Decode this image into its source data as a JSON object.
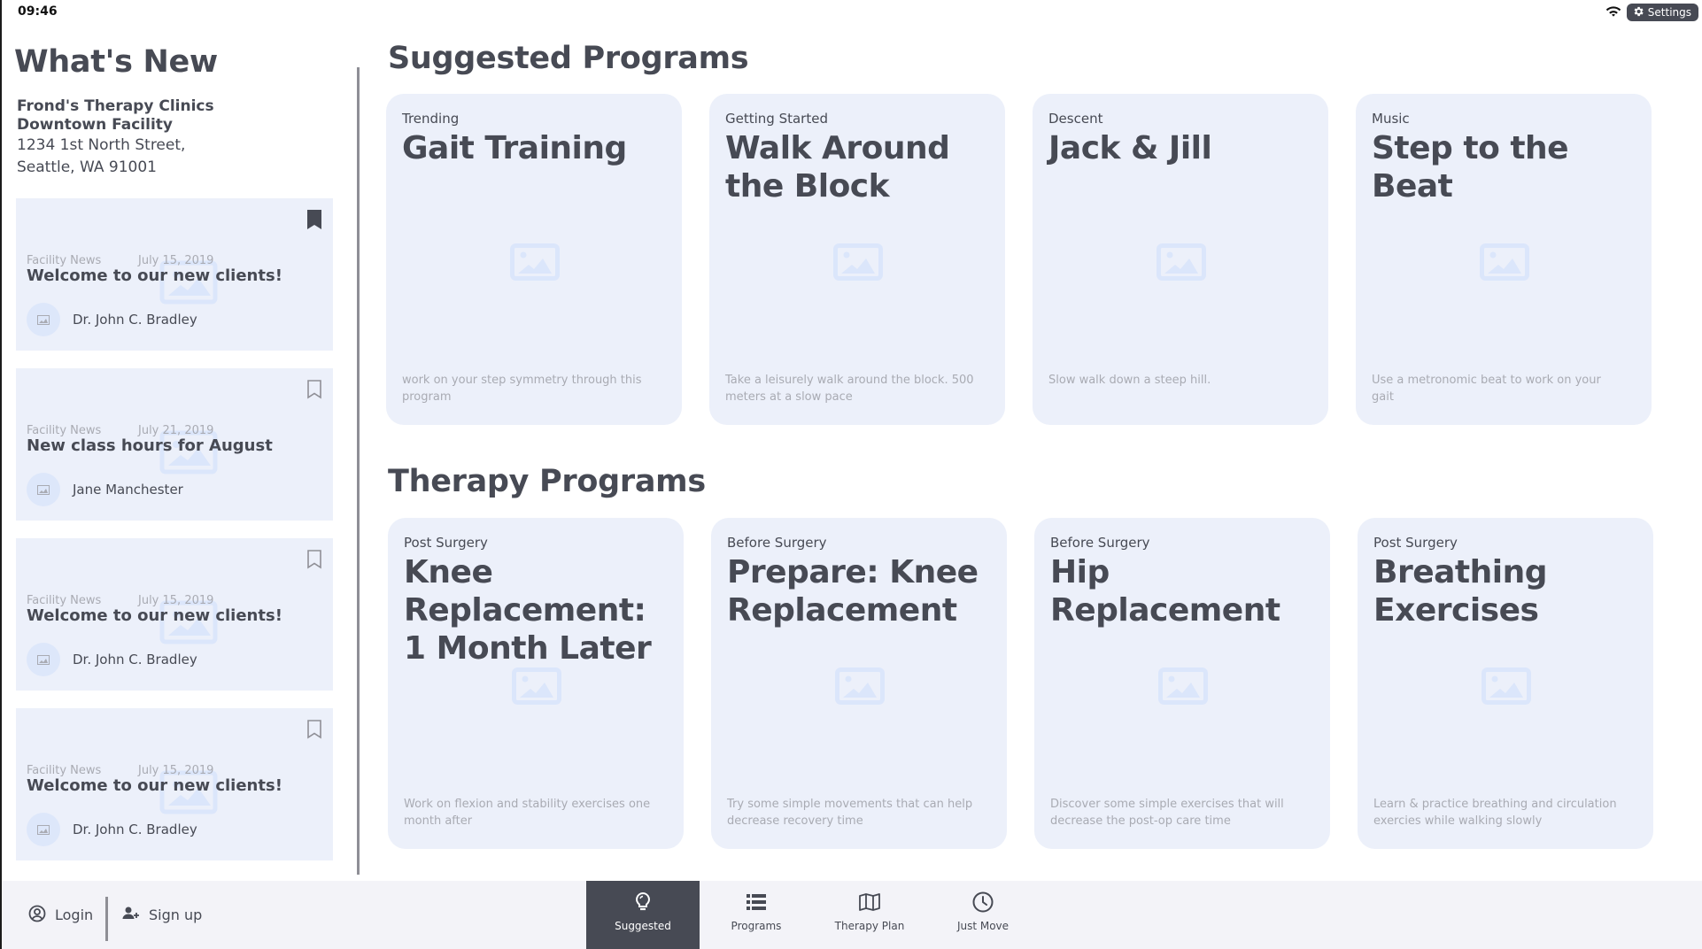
{
  "status_bar": {
    "time": "09:46",
    "wifi_icon": "wifi-icon",
    "settings_label": "Settings",
    "settings_icon": "gear-icon"
  },
  "sidebar": {
    "title": "What's New",
    "facility": {
      "name": "Frond's Therapy Clinics",
      "branch": "Downtown Facility",
      "address_line1": "1234 1st North Street,",
      "address_line2": "Seattle, WA 91001"
    },
    "news": [
      {
        "category": "Facility News",
        "date": "July 15, 2019",
        "title": "Welcome to our new clients!",
        "author": "Dr. John C. Bradley",
        "bookmarked": true
      },
      {
        "category": "Facility News",
        "date": "July 21, 2019",
        "title": "New class hours for August",
        "author": "Jane Manchester",
        "bookmarked": false
      },
      {
        "category": "Facility News",
        "date": "July 15, 2019",
        "title": "Welcome to our new clients!",
        "author": "Dr. John C. Bradley",
        "bookmarked": false
      },
      {
        "category": "Facility News",
        "date": "July 15, 2019",
        "title": "Welcome to our new clients!",
        "author": "Dr. John C. Bradley",
        "bookmarked": false
      }
    ]
  },
  "suggested": {
    "title": "Suggested Programs",
    "programs": [
      {
        "category": "Trending",
        "title": "Gait Training",
        "description": "work on your step symmetry through this program"
      },
      {
        "category": "Getting Started",
        "title": "Walk Around the Block",
        "description": "Take a leisurely walk around the block. 500 meters at a slow pace"
      },
      {
        "category": "Descent",
        "title": "Jack & Jill",
        "description": "Slow walk down a steep hill."
      },
      {
        "category": "Music",
        "title": "Step to the Beat",
        "description": "Use a metronomic beat to work on your gait"
      }
    ]
  },
  "therapy": {
    "title": "Therapy Programs",
    "programs": [
      {
        "category": "Post Surgery",
        "title": "Knee Replacement: 1 Month Later",
        "description": "Work on flexion and stability exercises one month after"
      },
      {
        "category": "Before Surgery",
        "title": "Prepare: Knee Replacement",
        "description": "Try some simple movements that can help decrease recovery time"
      },
      {
        "category": "Before Surgery",
        "title": "Hip Replacement",
        "description": "Discover some simple exercises that will decrease the post-op care time"
      },
      {
        "category": "Post Surgery",
        "title": "Breathing Exercises",
        "description": "Learn & practice breathing and circulation exercies while walking slowly"
      }
    ]
  },
  "bottom_bar": {
    "login_label": "Login",
    "signup_label": "Sign up",
    "tabs": [
      {
        "label": "Suggested",
        "icon": "lightbulb-icon",
        "active": true
      },
      {
        "label": "Programs",
        "icon": "list-icon",
        "active": false
      },
      {
        "label": "Therapy Plan",
        "icon": "map-icon",
        "active": false
      },
      {
        "label": "Just Move",
        "icon": "clock-icon",
        "active": false
      }
    ]
  },
  "colors": {
    "text_primary": "#474a54",
    "text_muted": "#a9abb3",
    "card_bg": "#ecf0fa",
    "active_tab_bg": "#474a54",
    "bottom_bar_bg": "#f3f3f8",
    "placeholder_icon": "#dbe6fb"
  }
}
